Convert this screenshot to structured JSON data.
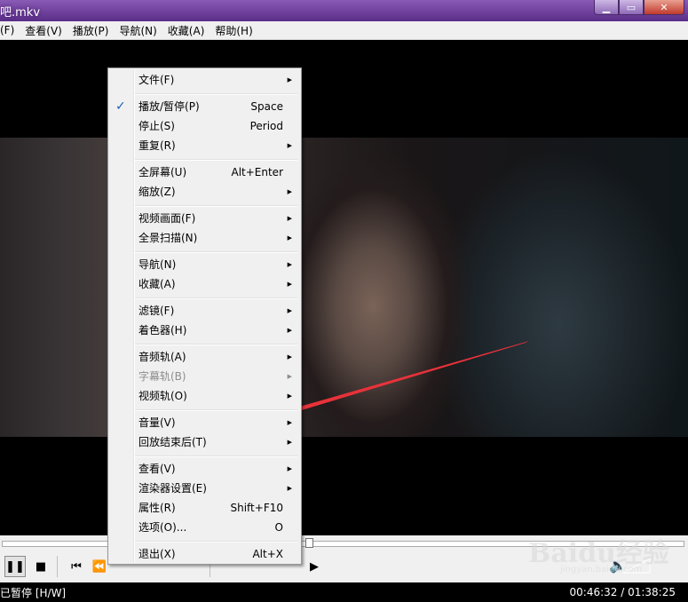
{
  "window": {
    "title": "吧.mkv"
  },
  "menubar": [
    "(F)",
    "查看(V)",
    "播放(P)",
    "导航(N)",
    "收藏(A)",
    "帮助(H)"
  ],
  "context_menu": {
    "items": [
      {
        "label": "文件(F)",
        "submenu": true
      },
      {
        "label": "播放/暂停(P)",
        "shortcut": "Space",
        "checked": true
      },
      {
        "label": "停止(S)",
        "shortcut": "Period"
      },
      {
        "label": "重复(R)",
        "submenu": true
      },
      {
        "label": "全屏幕(U)",
        "shortcut": "Alt+Enter"
      },
      {
        "label": "缩放(Z)",
        "submenu": true
      },
      {
        "label": "视频画面(F)",
        "submenu": true
      },
      {
        "label": "全景扫描(N)",
        "submenu": true
      },
      {
        "label": "导航(N)",
        "submenu": true
      },
      {
        "label": "收藏(A)",
        "submenu": true
      },
      {
        "label": "滤镜(F)",
        "submenu": true
      },
      {
        "label": "着色器(H)",
        "submenu": true
      },
      {
        "label": "音频轨(A)",
        "submenu": true
      },
      {
        "label": "字幕轨(B)",
        "submenu": true,
        "disabled": true
      },
      {
        "label": "视频轨(O)",
        "submenu": true
      },
      {
        "label": "音量(V)",
        "submenu": true
      },
      {
        "label": "回放结束后(T)",
        "submenu": true
      },
      {
        "label": "查看(V)",
        "submenu": true
      },
      {
        "label": "渲染器设置(E)",
        "submenu": true
      },
      {
        "label": "属性(R)",
        "shortcut": "Shift+F10"
      },
      {
        "label": "选项(O)...",
        "shortcut": "O"
      },
      {
        "label": "退出(X)",
        "shortcut": "Alt+X"
      }
    ]
  },
  "status": {
    "state": "已暂停 [H/W]",
    "time": "00:46:32 / 01:38:25"
  },
  "watermark": {
    "brand": "Baidu经验",
    "site": "jingyan.baidu.com"
  },
  "icons": {
    "check": "checkmark-icon",
    "submenu": "submenu-arrow-icon",
    "pause": "pause-icon",
    "stop": "stop-icon",
    "prev": "skip-back-icon",
    "rew": "rewind-icon",
    "fwd": "fast-forward-icon",
    "next": "skip-forward-icon",
    "frame": "frame-step-icon",
    "volume": "speaker-icon"
  },
  "colors": {
    "titlebar": "#6b3ea0",
    "check": "#1e62b5",
    "annotation_arrow": "#e8323a"
  }
}
